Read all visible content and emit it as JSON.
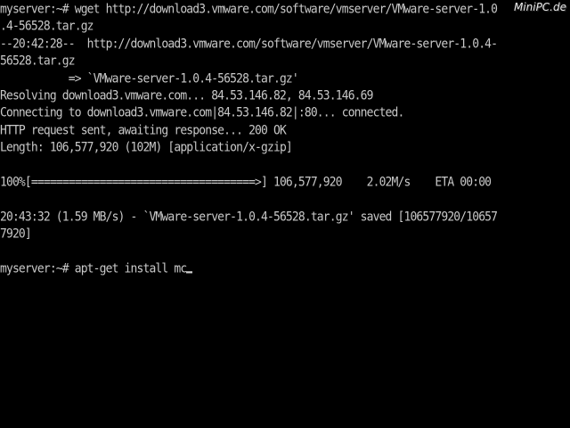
{
  "watermark": "MiniPC.de",
  "terminal": {
    "lines": [
      "myserver:~# wget http://download3.vmware.com/software/vmserver/VMware-server-1.0",
      ".4-56528.tar.gz",
      "--20:42:28--  http://download3.vmware.com/software/vmserver/VMware-server-1.0.4-",
      "56528.tar.gz",
      "           => `VMware-server-1.0.4-56528.tar.gz'",
      "Resolving download3.vmware.com... 84.53.146.82, 84.53.146.69",
      "Connecting to download3.vmware.com|84.53.146.82|:80... connected.",
      "HTTP request sent, awaiting response... 200 OK",
      "Length: 106,577,920 (102M) [application/x-gzip]",
      "",
      "100%[====================================>] 106,577,920    2.02M/s    ETA 00:00",
      "",
      "20:43:32 (1.59 MB/s) - `VMware-server-1.0.4-56528.tar.gz' saved [106577920/10657",
      "7920]",
      "",
      "myserver:~# apt-get install mc"
    ]
  }
}
